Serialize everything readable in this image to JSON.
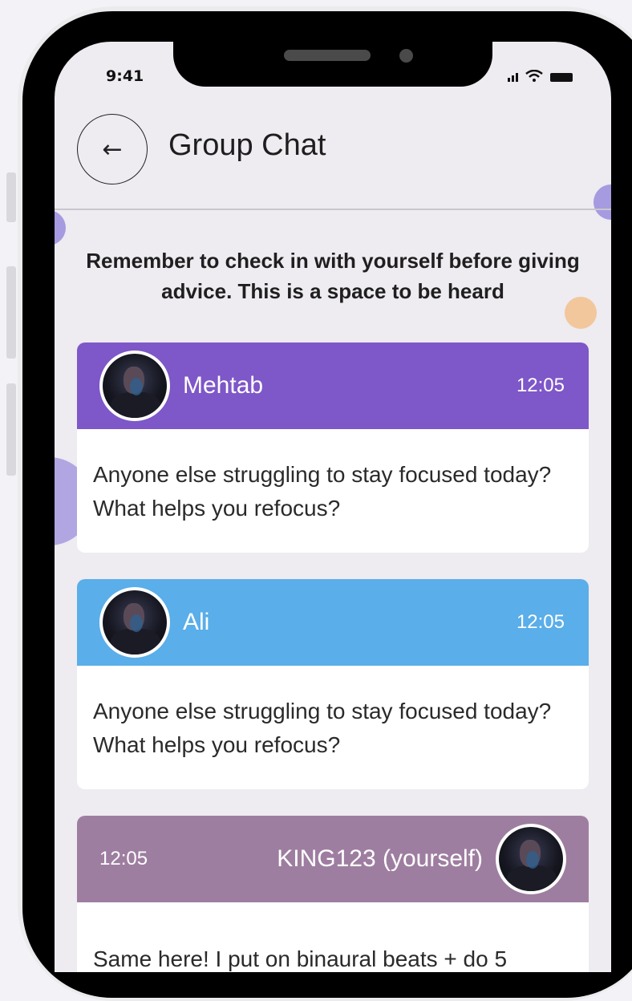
{
  "status_bar": {
    "time": "9:41"
  },
  "header": {
    "back_icon": "←",
    "title": "Group Chat"
  },
  "notice": "Remember to check in with yourself before giving advice. This is a space to be heard",
  "messages": [
    {
      "sender": "Mehtab",
      "time": "12:05",
      "text": "Anyone else struggling to stay focused today? What helps you refocus?",
      "color": "#7e57c8"
    },
    {
      "sender": "Ali",
      "time": "12:05",
      "text": "Anyone else struggling to stay focused today? What helps you refocus?",
      "color": "#5aaee9"
    },
    {
      "sender": "KING123 (yourself)",
      "time": "12:05",
      "text": "Same here! I put on binaural beats + do 5",
      "color": "#9e7ea0"
    }
  ]
}
